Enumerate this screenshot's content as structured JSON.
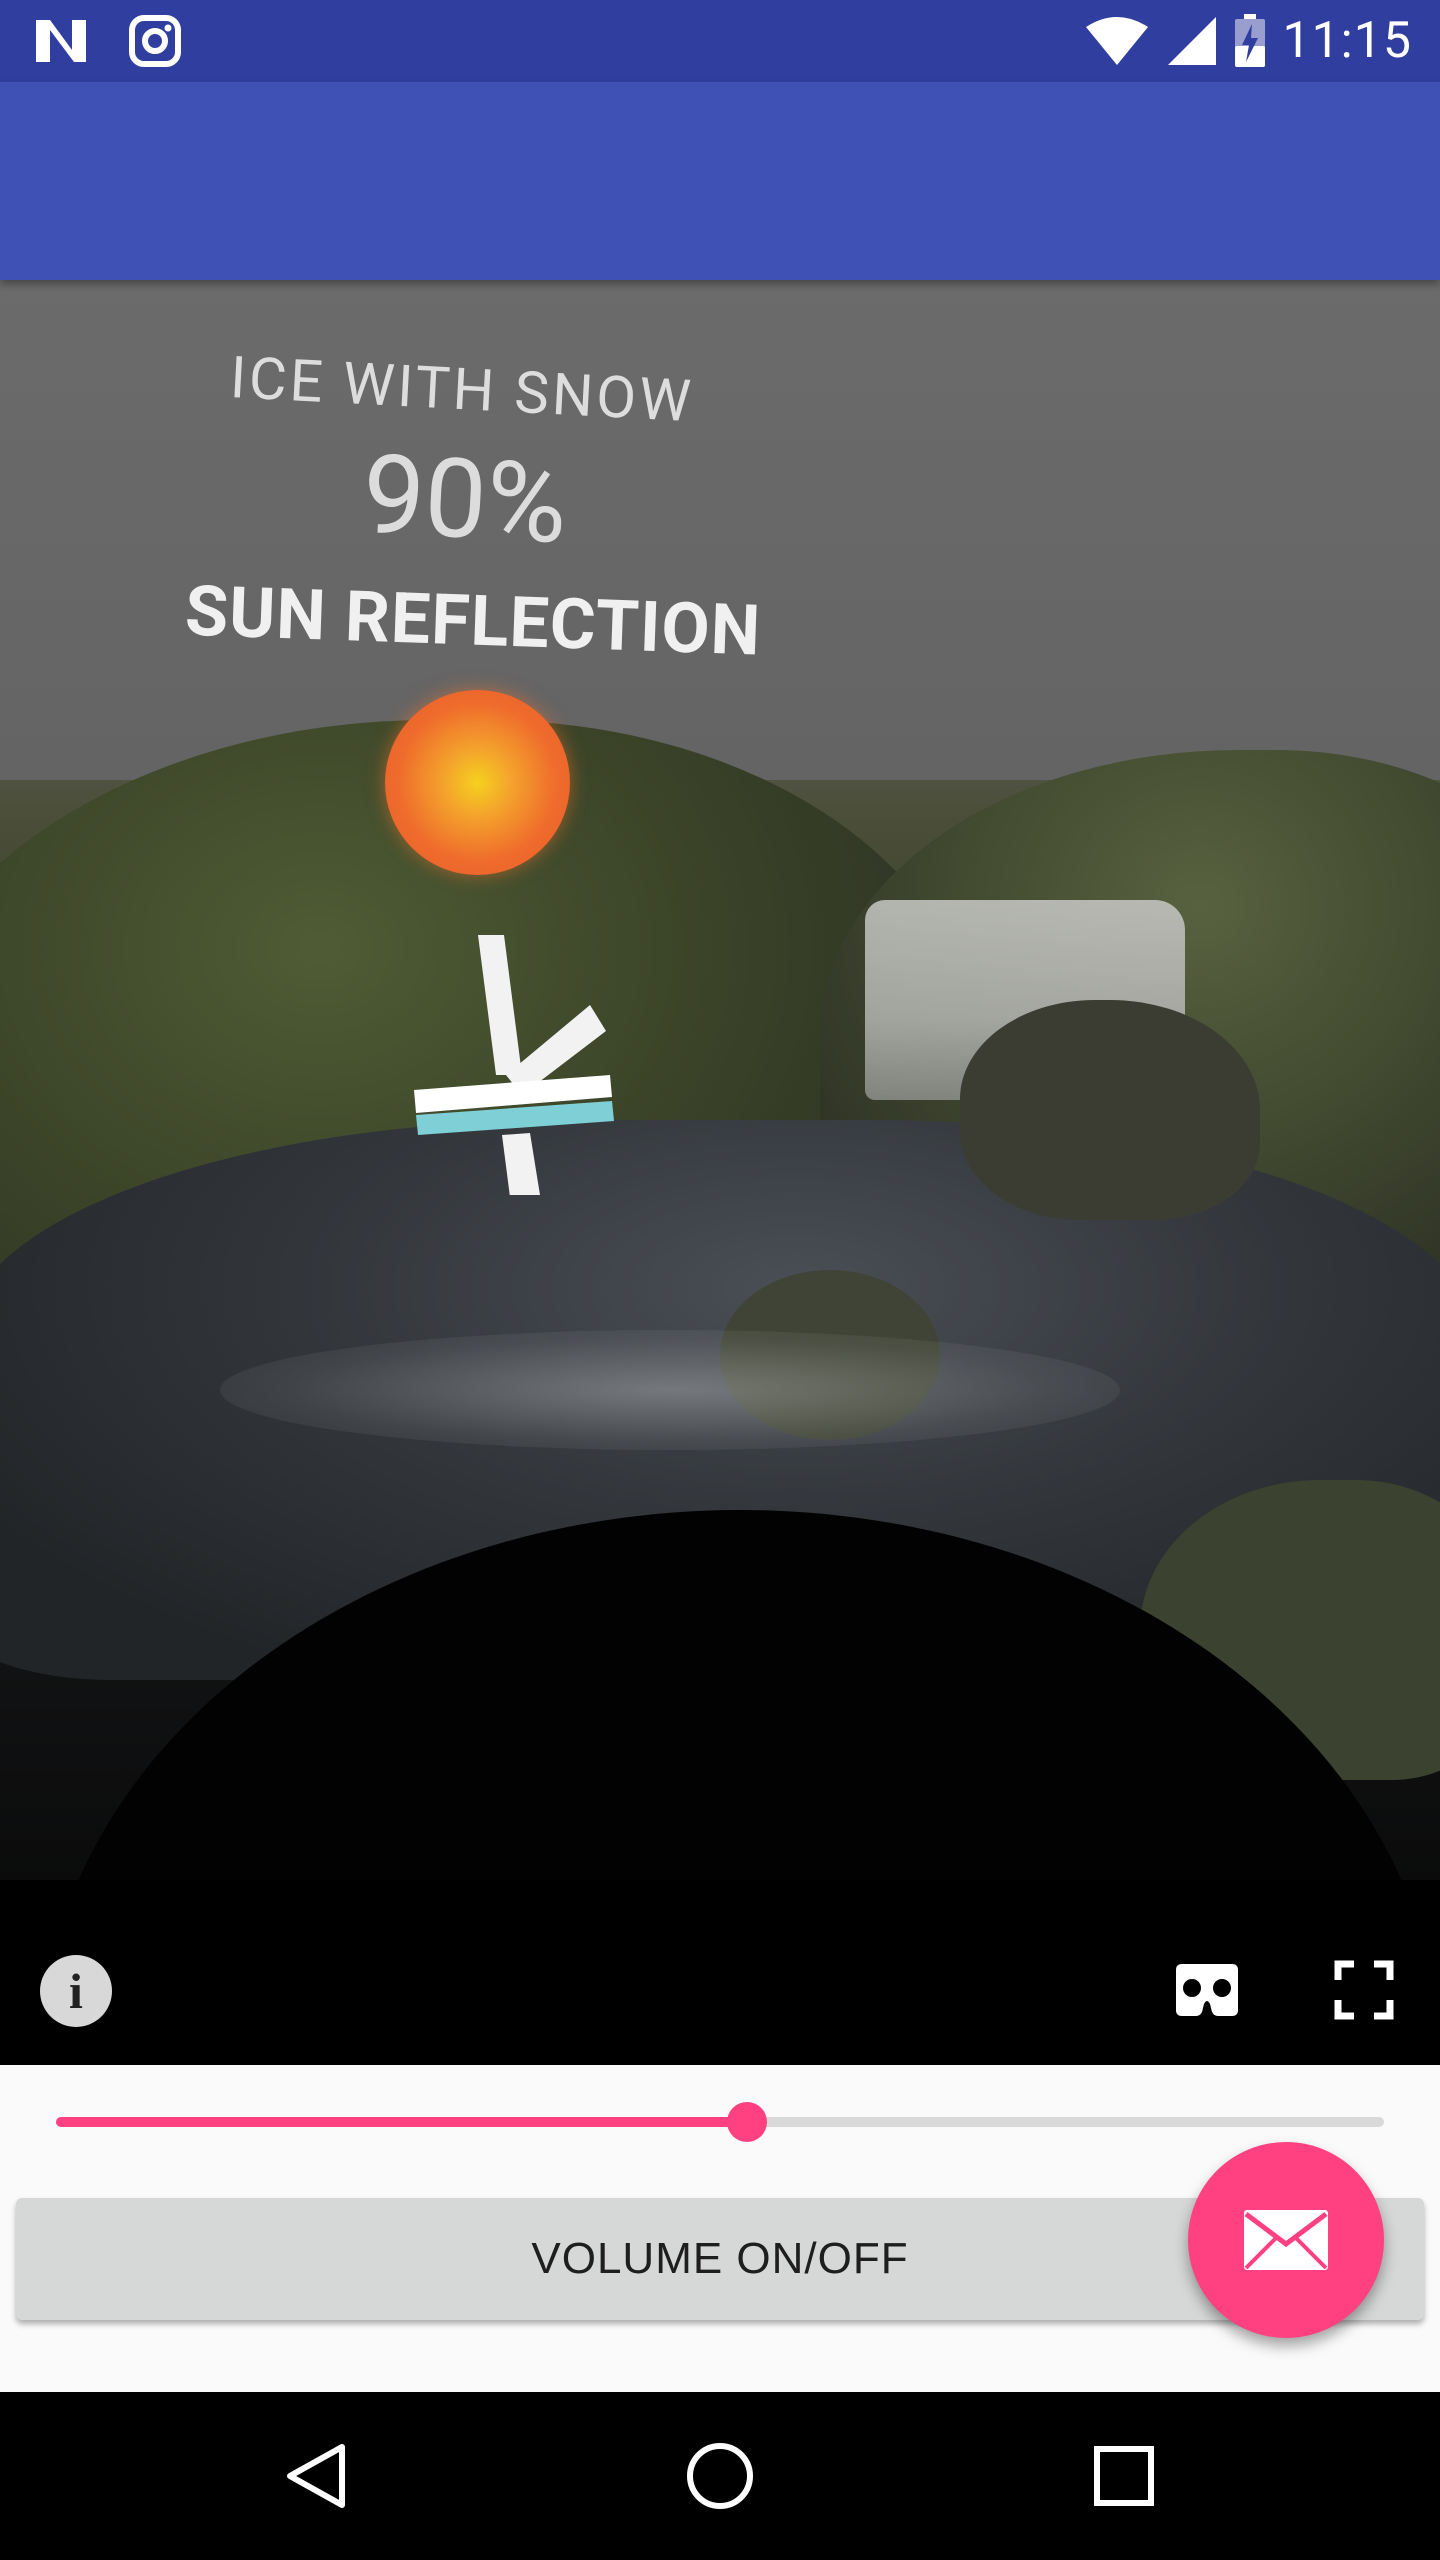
{
  "status_bar": {
    "time": "11:15",
    "icons": [
      "notification-n-icon",
      "instagram-icon",
      "wifi-icon",
      "cellular-signal-icon",
      "battery-charging-icon"
    ]
  },
  "app_bar": {
    "title": ""
  },
  "video": {
    "overlay": {
      "line1": "ICE WITH SNOW",
      "line2": "90%",
      "line3": "SUN REFLECTION"
    },
    "controls": [
      "info-icon",
      "cardboard-vr-icon",
      "fullscreen-icon"
    ]
  },
  "seek": {
    "progress": 0.52
  },
  "volume_button": {
    "label": "VOLUME ON/OFF"
  },
  "fab": {
    "icon": "email-icon",
    "color": "#ff4081"
  },
  "nav_bar": {
    "icons": [
      "back-icon",
      "home-icon",
      "recents-icon"
    ]
  },
  "colors": {
    "primary": "#3f51b5",
    "primary_dark": "#303f9f",
    "accent": "#ff4081"
  }
}
